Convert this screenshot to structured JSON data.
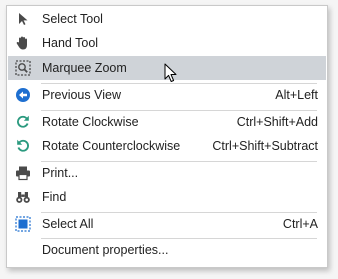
{
  "menu": {
    "items": [
      {
        "label": "Select Tool",
        "shortcut": "",
        "icon": "arrow-pointer-icon"
      },
      {
        "label": "Hand Tool",
        "shortcut": "",
        "icon": "hand-icon"
      },
      {
        "label": "Marquee Zoom",
        "shortcut": "",
        "icon": "marquee-zoom-icon",
        "highlighted": true
      },
      {
        "label": "Previous View",
        "shortcut": "Alt+Left",
        "icon": "back-arrow-icon"
      },
      {
        "label": "Rotate Clockwise",
        "shortcut": "Ctrl+Shift+Add",
        "icon": "rotate-clockwise-icon"
      },
      {
        "label": "Rotate Counterclockwise",
        "shortcut": "Ctrl+Shift+Subtract",
        "icon": "rotate-counterclockwise-icon"
      },
      {
        "label": "Print...",
        "shortcut": "",
        "icon": "printer-icon"
      },
      {
        "label": "Find",
        "shortcut": "",
        "icon": "binoculars-icon"
      },
      {
        "label": "Select All",
        "shortcut": "Ctrl+A",
        "icon": "select-all-icon"
      },
      {
        "label": "Document properties...",
        "shortcut": "",
        "icon": ""
      }
    ]
  },
  "colors": {
    "highlight": "#cfd3d8",
    "accent_blue": "#1e6fd0",
    "icon_gray": "#5a5a5a",
    "rotate_green": "#2b9a7f"
  }
}
